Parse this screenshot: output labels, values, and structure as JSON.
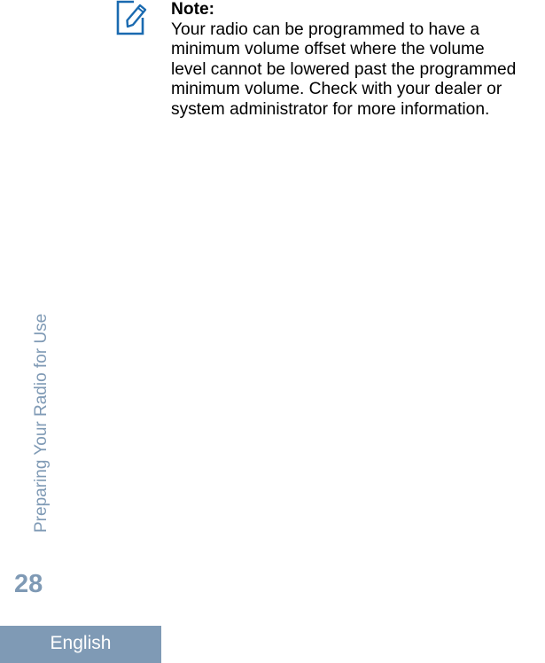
{
  "note": {
    "icon": "pencil-edit-icon",
    "title": "Note:",
    "lines": [
      "Your radio can be programmed to have a",
      "minimum volume offset where the volume",
      "level cannot be lowered past the programmed",
      "minimum volume. Check with your dealer or",
      "system administrator for more information."
    ]
  },
  "sidebar": {
    "section_title": "Preparing Your Radio for Use",
    "page_number": "28",
    "language": "English"
  },
  "colors": {
    "accent": "#7f9ab5",
    "icon_blue": "#1a6ab0"
  }
}
